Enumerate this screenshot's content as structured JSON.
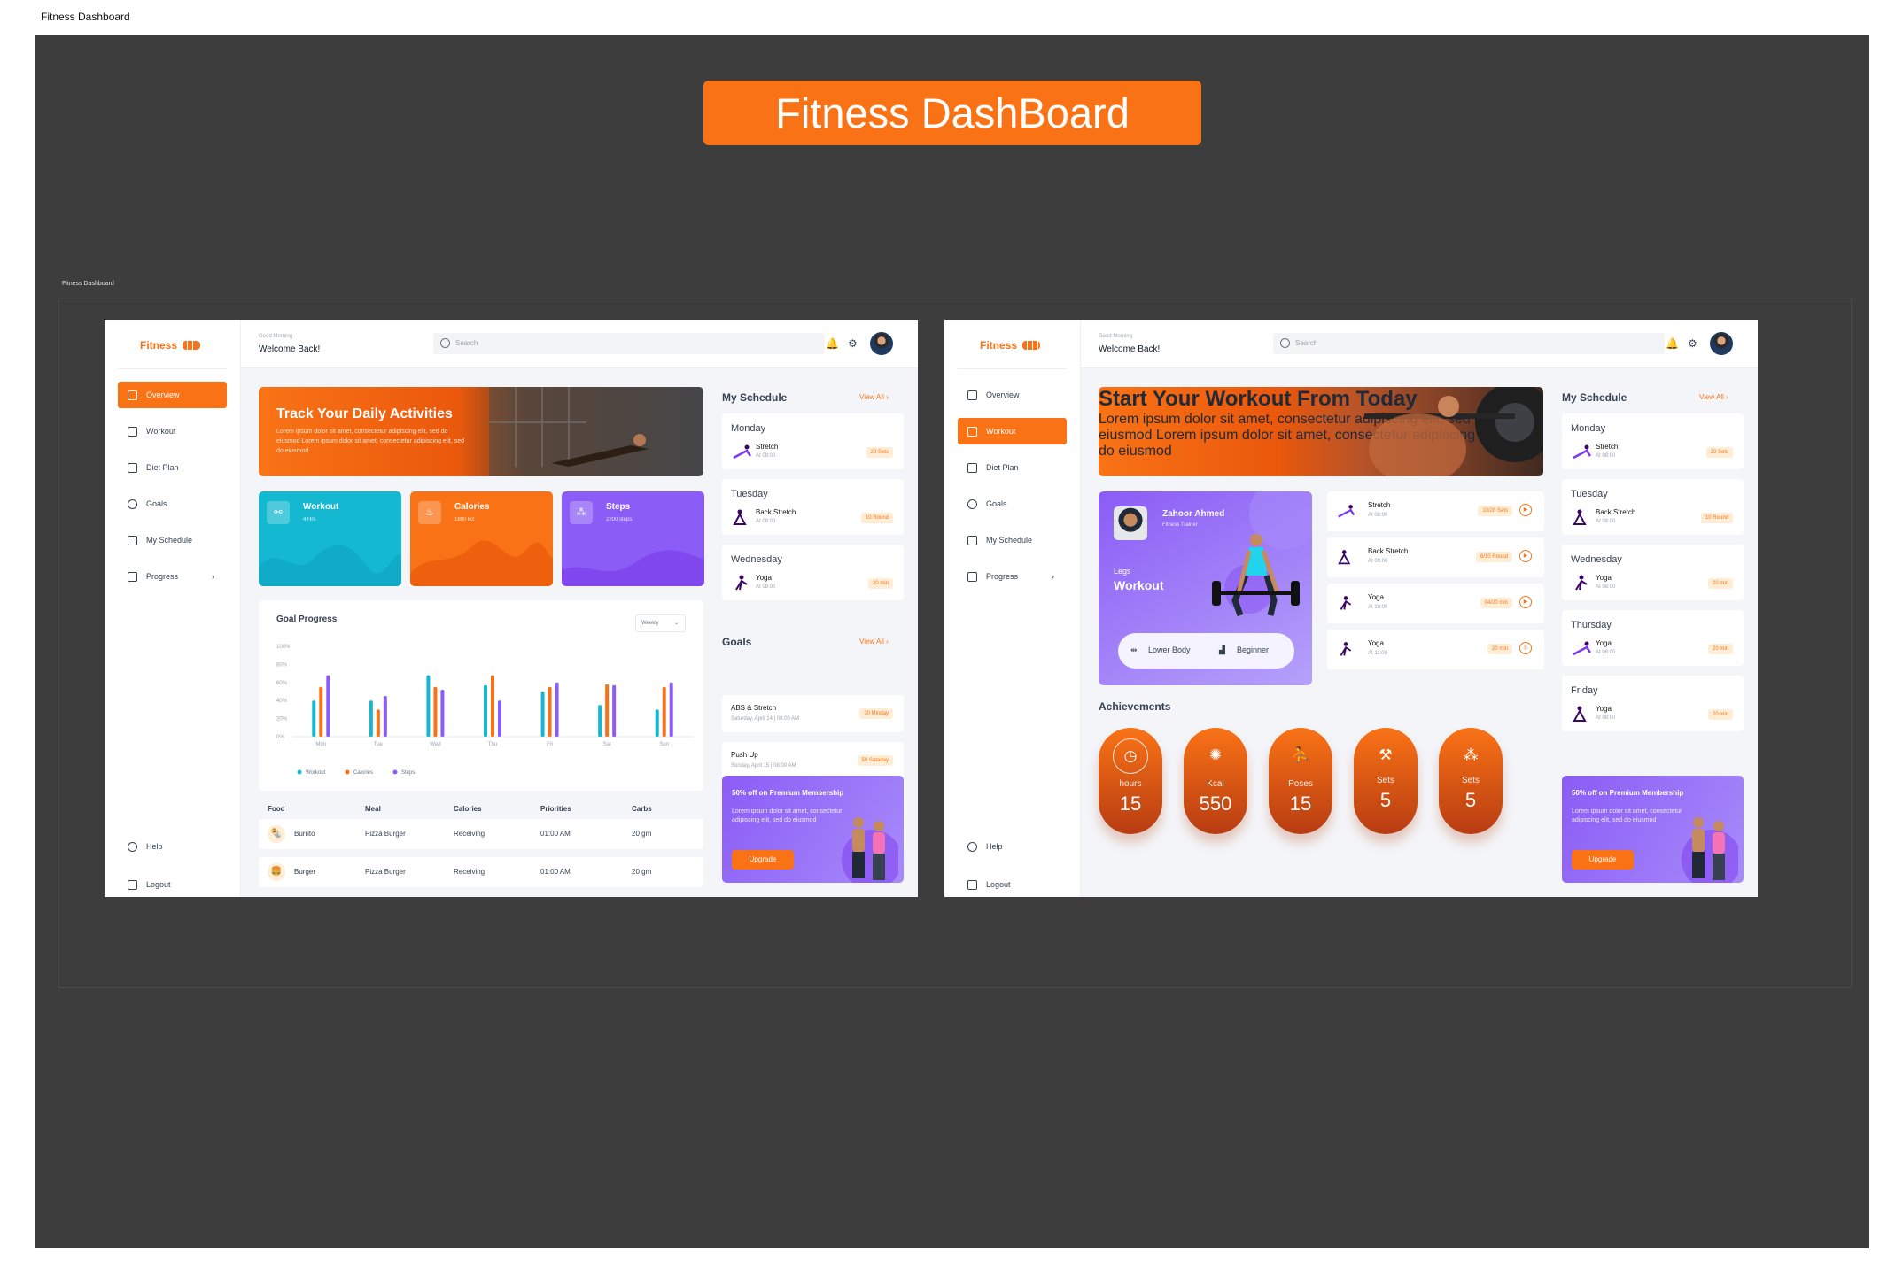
{
  "doc_title": "Fitness Dashboard",
  "banner": "Fitness DashBoard",
  "frame_label": "Fitness Dashboard",
  "colors": {
    "accent": "#f97316",
    "teal": "#14b8d0",
    "purple": "#8b5cf6"
  },
  "brand": "Fitness",
  "topbar": {
    "greet_small": "Good Morning",
    "greet": "Welcome Back!",
    "search_placeholder": "Search",
    "icons": [
      "bell-icon",
      "gear-icon"
    ]
  },
  "nav": [
    "Overview",
    "Workout",
    "Diet Plan",
    "Goals",
    "My Schedule",
    "Progress"
  ],
  "nav_bottom": [
    "Help",
    "Logout"
  ],
  "screen1": {
    "hero": {
      "title": "Track Your Daily Activities",
      "text": "Lorem ipsum dolor sit amet, consectetur adipiscing elit, sed do eiusmod Lorem ipsum dolor sit amet, consectetur adipiscing elit, sed do eiusmod"
    },
    "stats": [
      {
        "title": "Workout",
        "sub": "4 Hrs",
        "icon": "dumbbell-icon"
      },
      {
        "title": "Calories",
        "sub": "1800 kcl",
        "icon": "flame-icon"
      },
      {
        "title": "Steps",
        "sub": "2200 steps",
        "icon": "footprint-icon"
      }
    ],
    "goal_progress": {
      "title": "Goal Progress",
      "period": "Weekly"
    },
    "table": {
      "headers": [
        "Food",
        "Meal",
        "Calories",
        "Priorities",
        "Carbs"
      ],
      "rows": [
        [
          "Burrito",
          "Pizza Burger",
          "Receiving",
          "01:00 AM",
          "20 gm"
        ],
        [
          "Burger",
          "Pizza Burger",
          "Receiving",
          "01:00 AM",
          "20 gm"
        ]
      ]
    },
    "schedule_title": "My Schedule",
    "view_all": "View All",
    "schedule": [
      {
        "day": "Monday",
        "name": "Stretch",
        "at": "At 08:00",
        "badge": "20 Sets"
      },
      {
        "day": "Tuesday",
        "name": "Back Stretch",
        "at": "At 08:00",
        "badge": "10 Round"
      },
      {
        "day": "Wednesday",
        "name": "Yoga",
        "at": "At 08:00",
        "badge": "20 min"
      }
    ],
    "goals_title": "Goals",
    "goals": [
      {
        "name": "ABS & Stretch",
        "date": "Saturday, April 14 | 08:00 AM",
        "badge": "30 Minday"
      },
      {
        "name": "Push Up",
        "date": "Sunday, April 15 | 08:00 AM",
        "badge": "50 Sataday"
      }
    ]
  },
  "promo": {
    "title": "50% off on Premium Membership",
    "text": "Lorem ipsum dolor sit amet, consectetur adipiscing elit, sed do eiusmod",
    "button": "Upgrade"
  },
  "chart_data": {
    "type": "bar",
    "title": "Goal Progress",
    "categories": [
      "Mon",
      "Tue",
      "Wed",
      "Thu",
      "Fri",
      "Sat",
      "Sun"
    ],
    "y_ticks": [
      "100%",
      "80%",
      "60%",
      "40%",
      "20%",
      "0%"
    ],
    "ylim": [
      0,
      100
    ],
    "series": [
      {
        "name": "Workout",
        "color": "#14b8d0",
        "values": [
          40,
          40,
          68,
          57,
          50,
          35,
          30
        ]
      },
      {
        "name": "Calories",
        "color": "#f97316",
        "values": [
          55,
          30,
          55,
          68,
          55,
          58,
          55
        ]
      },
      {
        "name": "Steps",
        "color": "#8b5cf6",
        "values": [
          68,
          45,
          52,
          40,
          60,
          57,
          60
        ]
      }
    ],
    "legend": "bottom"
  },
  "screen2": {
    "hero": {
      "title": "Start Your Workout From Today",
      "text": "Lorem ipsum dolor sit amet, consectetur adipiscing elit, sed do eiusmod Lorem ipsum dolor sit amet, consectetur adipiscing elit, sed do eiusmod"
    },
    "trainer": {
      "name": "Zahoor Ahmed",
      "role": "Fitness Trainer",
      "label1": "Legs",
      "label2": "Workout",
      "pill_a": "Lower Body",
      "pill_b": "Beginner"
    },
    "workouts": [
      {
        "name": "Stretch",
        "at": "At 08:00",
        "badge": "10/20 Sets"
      },
      {
        "name": "Back Stretch",
        "at": "At 09:00",
        "badge": "6/10 Round"
      },
      {
        "name": "Yoga",
        "at": "At 10:00",
        "badge": "04/20 min"
      },
      {
        "name": "Yoga",
        "at": "At 11:00",
        "badge": "20 min"
      }
    ],
    "achievements_title": "Achievements",
    "achievements": [
      {
        "label": "hours",
        "value": "15",
        "icon": "clock-icon"
      },
      {
        "label": "Kcal",
        "value": "550",
        "icon": "flame-icon"
      },
      {
        "label": "Poses",
        "value": "15",
        "icon": "pose-icon"
      },
      {
        "label": "Sets",
        "value": "5",
        "icon": "dumbbell-icon"
      },
      {
        "label": "Sets",
        "value": "5",
        "icon": "footprint-icon"
      }
    ],
    "schedule": [
      {
        "day": "Monday",
        "name": "Stretch",
        "at": "At 08:00",
        "badge": "20 Sets"
      },
      {
        "day": "Tuesday",
        "name": "Back Stretch",
        "at": "At 08:00",
        "badge": "10 Round"
      },
      {
        "day": "Wednesday",
        "name": "Yoga",
        "at": "At 08:00",
        "badge": "20 min"
      },
      {
        "day": "Thursday",
        "name": "Yoga",
        "at": "At 08:00",
        "badge": "20 min"
      },
      {
        "day": "Friday",
        "name": "Yoga",
        "at": "At 08:00",
        "badge": "20 min"
      }
    ]
  }
}
